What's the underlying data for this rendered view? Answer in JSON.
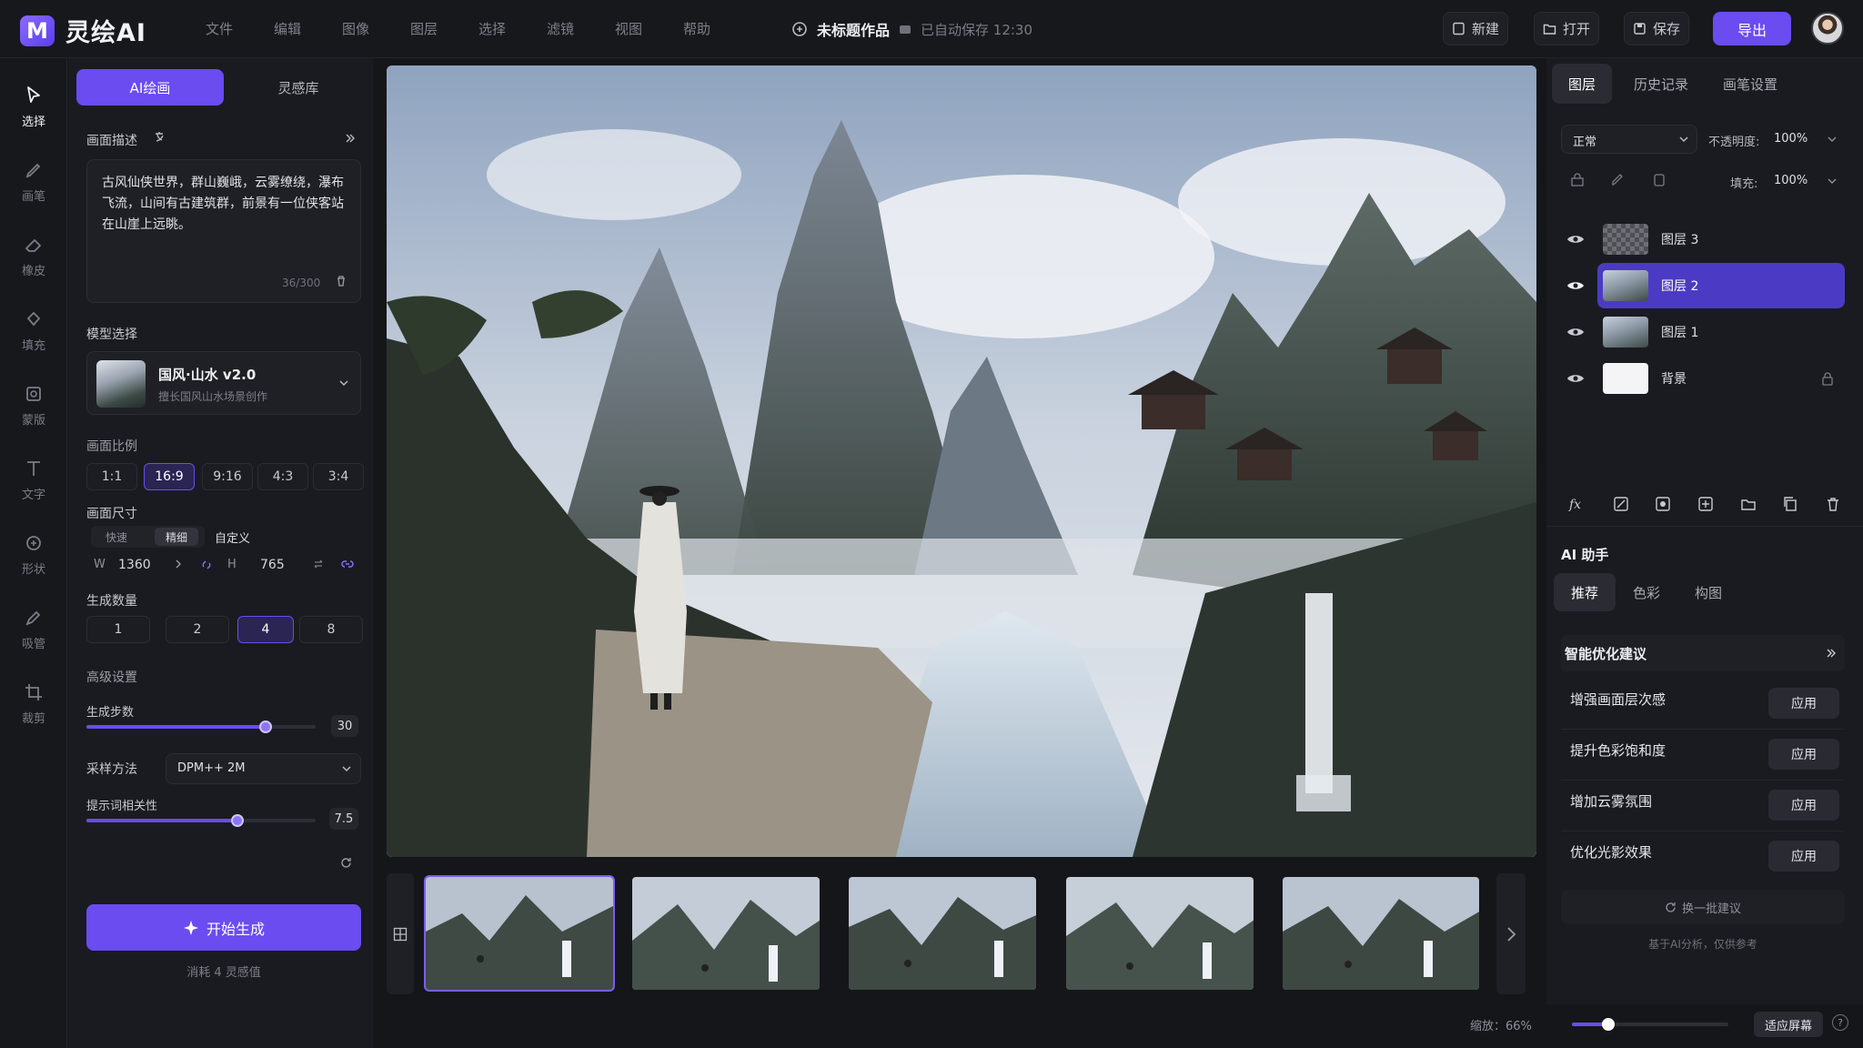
{
  "app": {
    "name": "灵绘AI",
    "brand_color": "#6a4cf0"
  },
  "menu": [
    "文件",
    "编辑",
    "图像",
    "图层",
    "选择",
    "滤镜",
    "视图",
    "帮助"
  ],
  "document": {
    "title": "未标题作品",
    "autosave": "已自动保存 12:30"
  },
  "header_actions": {
    "new": "新建",
    "open": "打开",
    "save": "保存",
    "export": "导出"
  },
  "tools": [
    {
      "label": "选择",
      "icon": "select-cursor-icon",
      "active": true
    },
    {
      "label": "画笔",
      "icon": "brush-icon"
    },
    {
      "label": "橡皮",
      "icon": "eraser-icon"
    },
    {
      "label": "填充",
      "icon": "fill-bucket-icon"
    },
    {
      "label": "蒙版",
      "icon": "mask-icon"
    },
    {
      "label": "文字",
      "icon": "text-icon"
    },
    {
      "label": "形状",
      "icon": "shape-icon"
    },
    {
      "label": "吸管",
      "icon": "eyedropper-icon"
    },
    {
      "label": "裁剪",
      "icon": "crop-icon"
    }
  ],
  "left_panel": {
    "tabs": [
      "AI绘画",
      "灵感库"
    ],
    "prompt_label": "画面描述",
    "prompt_text": "古风仙侠世界，群山巍峨，云雾缭绕，瀑布飞流，山间有古建筑群，前景有一位侠客站在山崖上远眺。",
    "prompt_count": "36/300",
    "model_label": "模型选择",
    "model_name": "国风·山水 v2.0",
    "model_desc": "擅长国风山水场景创作",
    "ratio_label": "画面比例",
    "ratios": [
      "1:1",
      "16:9",
      "9:16",
      "4:3",
      "3:4"
    ],
    "ratio_selected": "16:9",
    "size_label": "画面尺寸",
    "size_modes": [
      "快速",
      "精细",
      "自定义"
    ],
    "size_w_label": "W",
    "size_w": "1360",
    "size_h_label": "H",
    "size_h": "765",
    "count_label": "生成数量",
    "counts": [
      "1",
      "2",
      "4",
      "8"
    ],
    "count_selected": "4",
    "advanced_label": "高级设置",
    "steps_label": "生成步数",
    "steps_value": "30",
    "steps_fraction": 0.78,
    "sampler_label": "采样方法",
    "sampler_value": "DPM++ 2M",
    "cfg_label": "提示词相关性",
    "cfg_value": "7.5",
    "cfg_fraction": 0.66,
    "generate_label": "开始生成",
    "cost_text": "消耗 4 灵感值"
  },
  "right_panel": {
    "tabs": [
      "图层",
      "历史记录",
      "画笔设置"
    ],
    "blend_mode": "正常",
    "opacity_label": "不透明度:",
    "opacity_value": "100%",
    "fill_label": "填充:",
    "fill_value": "100%",
    "layers": [
      {
        "name": "图层 3",
        "selected": false
      },
      {
        "name": "图层 2",
        "selected": true
      },
      {
        "name": "图层 1",
        "selected": false
      },
      {
        "name": "背景",
        "selected": false,
        "locked": true
      }
    ],
    "assistant_title": "AI 助手",
    "assistant_tabs": [
      "推荐",
      "色彩",
      "构图"
    ],
    "suggest_title": "智能优化建议",
    "suggestions": [
      {
        "title": "增强画面层次感",
        "action": "应用"
      },
      {
        "title": "提升色彩饱和度",
        "action": "应用"
      },
      {
        "title": "增加云雾氛围",
        "action": "应用"
      },
      {
        "title": "优化光影效果",
        "action": "应用"
      }
    ],
    "refresh_label": "换一批建议",
    "footnote": "基于AI分析，仅供参考"
  },
  "bottom": {
    "zoom_label": "缩放：66%",
    "zoom_fraction": 0.23,
    "fit_label": "适应屏幕",
    "help": "?"
  }
}
